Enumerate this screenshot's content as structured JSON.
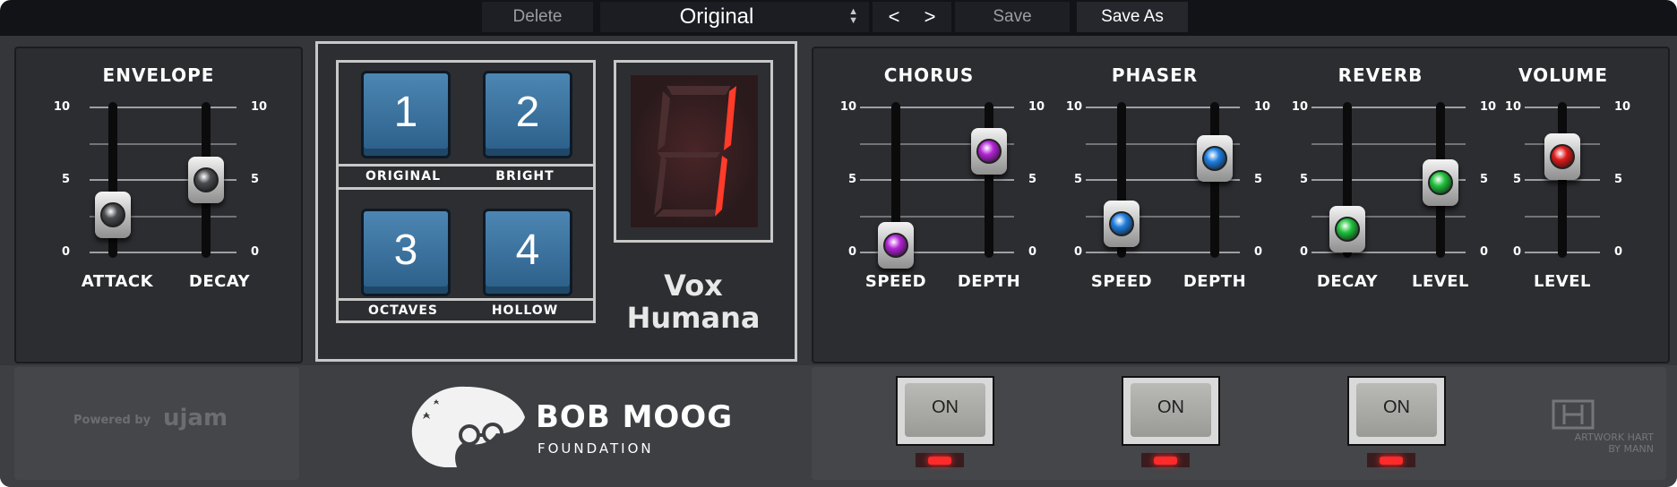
{
  "toolbar": {
    "delete_label": "Delete",
    "preset_name": "Original",
    "prev_label": "<",
    "next_label": ">",
    "save_label": "Save",
    "save_as_label": "Save As"
  },
  "envelope": {
    "title": "ENVELOPE",
    "scale": {
      "max": "10",
      "mid": "5",
      "min": "0"
    },
    "attack_label": "ATTACK",
    "decay_label": "DECAY",
    "attack_value": 2.6,
    "decay_value": 5.0
  },
  "voices": {
    "buttons": [
      {
        "number": "1",
        "label": "ORIGINAL"
      },
      {
        "number": "2",
        "label": "BRIGHT"
      },
      {
        "number": "3",
        "label": "OCTAVES"
      },
      {
        "number": "4",
        "label": "HOLLOW"
      }
    ],
    "display_digit": "1",
    "name_line1": "Vox",
    "name_line2": "Humana"
  },
  "effects": {
    "chorus": {
      "title": "CHORUS",
      "speed_label": "SPEED",
      "depth_label": "DEPTH",
      "speed_value": 0.5,
      "depth_value": 7.0,
      "on_label": "ON"
    },
    "phaser": {
      "title": "PHASER",
      "speed_label": "SPEED",
      "depth_label": "DEPTH",
      "speed_value": 2.0,
      "depth_value": 6.5,
      "on_label": "ON"
    },
    "reverb": {
      "title": "REVERB",
      "decay_label": "DECAY",
      "level_label": "LEVEL",
      "decay_value": 1.6,
      "level_value": 4.8,
      "on_label": "ON"
    },
    "volume": {
      "title": "VOLUME",
      "level_label": "LEVEL",
      "level_value": 6.6
    },
    "scale": {
      "max": "10",
      "mid": "5",
      "min": "0"
    }
  },
  "footer": {
    "powered_by": "Powered by",
    "ujam": "ujam",
    "moog_name": "BOB MOOG",
    "moog_sub": "FOUNDATION",
    "artwork_line1": "ARTWORK HART",
    "artwork_line2": "BY MANN"
  },
  "colors": {
    "envelope_knob": "#4a4c50",
    "chorus_knob": "#b323d6",
    "phaser_knob": "#1f7fe0",
    "reverb_knob": "#1fc23b",
    "volume_knob": "#e01a1a",
    "led": "#ff2a2a",
    "voice_button": "#3a7aa8"
  }
}
